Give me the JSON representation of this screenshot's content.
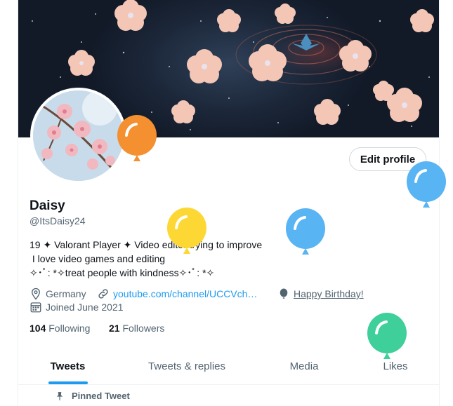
{
  "profile": {
    "name": "Daisy",
    "handle": "@ItsDaisy24",
    "bio_lines": [
      "19 ✦ Valorant Player ✦ Video editor trying to improve",
      " I love video games and editing",
      "✧･ﾟ: *✧treat people with kindness✧･ﾟ: *✧"
    ],
    "location": "Germany",
    "website": "youtube.com/channel/UCCVch…",
    "birthday": "Happy Birthday!",
    "joined": "Joined June 2021",
    "following_count": "104",
    "following_label": "Following",
    "followers_count": "21",
    "followers_label": "Followers",
    "edit_profile_label": "Edit profile"
  },
  "tabs": [
    {
      "label": "Tweets",
      "active": true
    },
    {
      "label": "Tweets & replies",
      "active": false
    },
    {
      "label": "Media",
      "active": false
    },
    {
      "label": "Likes",
      "active": false
    }
  ],
  "pinned_label": "Pinned Tweet",
  "icons": {
    "location": "location-pin-icon",
    "website": "link-icon",
    "birthday": "balloon-icon",
    "joined": "calendar-icon",
    "pinned": "pin-icon"
  },
  "colors": {
    "accent": "#1d9bf0",
    "secondary_text": "#536471",
    "balloon_orange": "#f4902f",
    "balloon_yellow": "#fdd835",
    "balloon_blue": "#58b4f2",
    "balloon_green": "#3fcf9a"
  }
}
